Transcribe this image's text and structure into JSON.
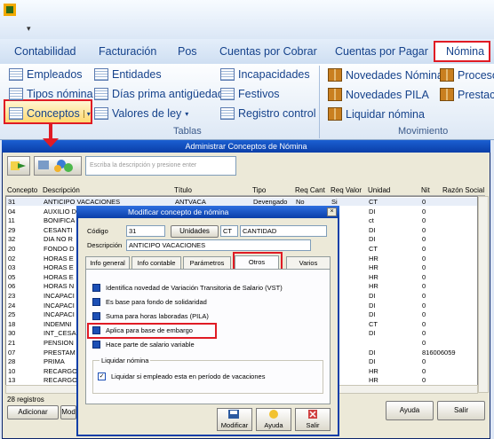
{
  "qat": {
    "arrow": "▾"
  },
  "tabs": [
    "Contabilidad",
    "Facturación",
    "Pos",
    "Cuentas por Cobrar",
    "Cuentas por Pagar",
    "Nómina"
  ],
  "ribbon": {
    "col1": [
      "Empleados",
      "Tipos nómina",
      "Conceptos"
    ],
    "col2": [
      "Entidades",
      "Días prima antigüedad",
      "Valores de ley"
    ],
    "col3": [
      "Incapacidades",
      "Festivos",
      "Registro control"
    ],
    "col4": [
      "Novedades Nómina",
      "Novedades PILA",
      "Liquidar nómina"
    ],
    "col5": [
      "Procesos",
      "Prestacio"
    ],
    "group_tablas": "Tablas",
    "group_movimiento": "Movimiento"
  },
  "window": {
    "title": "Administrar Conceptos de Nómina",
    "search_placeholder": "Escriba la descripción y presione enter",
    "columns": [
      "Concepto",
      "Descripción",
      "Título",
      "Tipo",
      "Req Cant",
      "Req Valor",
      "Unidad",
      "Nit",
      "Razón Social"
    ],
    "rows": [
      [
        "31",
        "ANTICIPO VACACIONES",
        "ANTVACA",
        "Devengado",
        "No",
        "Si",
        "CT",
        "0"
      ],
      [
        "04",
        "AUXILIO D",
        "",
        "",
        "",
        "",
        "DI",
        "0"
      ],
      [
        "11",
        "BONIFICA",
        "",
        "",
        "",
        "",
        "ct",
        "0"
      ],
      [
        "29",
        "CESANTI",
        "",
        "",
        "",
        "",
        "DI",
        "0"
      ],
      [
        "32",
        "DIA NO R",
        "",
        "",
        "",
        "",
        "DI",
        "0"
      ],
      [
        "20",
        "FONDO D",
        "",
        "",
        "",
        "",
        "CT",
        "0"
      ],
      [
        "02",
        "HORAS E",
        "",
        "",
        "",
        "",
        "HR",
        "0"
      ],
      [
        "03",
        "HORAS E",
        "",
        "",
        "",
        "",
        "HR",
        "0"
      ],
      [
        "05",
        "HORAS E",
        "",
        "",
        "",
        "",
        "HR",
        "0"
      ],
      [
        "06",
        "HORAS N",
        "",
        "",
        "",
        "",
        "HR",
        "0"
      ],
      [
        "23",
        "INCAPACI",
        "",
        "",
        "",
        "",
        "DI",
        "0"
      ],
      [
        "24",
        "INCAPACI",
        "",
        "",
        "",
        "",
        "DI",
        "0"
      ],
      [
        "25",
        "INCAPACI",
        "",
        "",
        "",
        "",
        "DI",
        "0"
      ],
      [
        "18",
        "INDEMNI",
        "",
        "",
        "",
        "",
        "CT",
        "0"
      ],
      [
        "30",
        "INT_CESA",
        "",
        "",
        "",
        "",
        "DI",
        "0"
      ],
      [
        "21",
        "PENSION",
        "",
        "",
        "",
        "",
        "",
        "0"
      ],
      [
        "07",
        "PRESTAM",
        "",
        "",
        "",
        "",
        "DI",
        "816006059"
      ],
      [
        "28",
        "PRIMA",
        "",
        "",
        "",
        "",
        "DI",
        "0"
      ],
      [
        "10",
        "RECARGO",
        "",
        "",
        "",
        "",
        "HR",
        "0"
      ],
      [
        "13",
        "RECARGO",
        "",
        "",
        "",
        "",
        "HR",
        "0"
      ]
    ],
    "count": "28 registros",
    "btn_add": "Adicionar",
    "btn_mod": "Mod",
    "btn_help": "Ayuda",
    "btn_exit": "Salir"
  },
  "dialog": {
    "title": "Modificar concepto de nómina",
    "codigo_label": "Código",
    "codigo_value": "31",
    "unidades_label": "Unidades",
    "unidad_code": "CT",
    "unidad_name": "CANTIDAD",
    "descripcion_label": "Descripción",
    "descripcion_value": "ANTICIPO VACACIONES",
    "tabs": [
      "Info general",
      "Info contable",
      "Parámetros",
      "Otros",
      "Varios"
    ],
    "options": [
      "Identifica novedad de Variación Transitoria de Salario (VST)",
      "Es base para fondo de solidaridad",
      "Suma para horas laboradas (PILA)",
      "Aplica para base de embargo",
      "Hace parte de salario variable"
    ],
    "group": "Liquidar nómina",
    "checkbox": "Liquidar si empleado esta en período de vacaciones",
    "btn_modify": "Modificar",
    "btn_help": "Ayuda",
    "btn_exit": "Salir"
  }
}
